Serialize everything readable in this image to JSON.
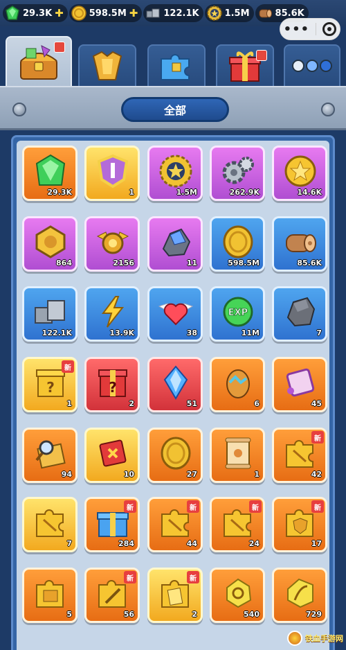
{
  "resources": [
    {
      "name": "gem",
      "value": "29.3K",
      "plus": true,
      "icon": "green-gem-icon",
      "color": "#3fcf5a"
    },
    {
      "name": "coin",
      "value": "598.5M",
      "plus": true,
      "icon": "gold-coin-icon",
      "color": "#f1c232"
    },
    {
      "name": "iron",
      "value": "122.1K",
      "plus": false,
      "icon": "iron-ingot-icon",
      "color": "#9aa4b0"
    },
    {
      "name": "medal",
      "value": "1.5M",
      "plus": false,
      "icon": "gear-medal-icon",
      "color": "#e5b93a"
    },
    {
      "name": "log",
      "value": "85.6K",
      "plus": false,
      "icon": "wood-log-icon",
      "color": "#b87845"
    }
  ],
  "capsule": {
    "more": "•••"
  },
  "tabs": [
    {
      "name": "treasure",
      "icon": "treasure-chest-icon",
      "active": true,
      "badge": true
    },
    {
      "name": "armor",
      "icon": "armor-icon",
      "active": false,
      "badge": false
    },
    {
      "name": "puzzle",
      "icon": "puzzle-piece-icon",
      "active": false,
      "badge": false
    },
    {
      "name": "gift",
      "icon": "gift-box-icon",
      "active": false,
      "badge": true
    },
    {
      "name": "more",
      "icon": "more-dots-icon",
      "active": false,
      "badge": false
    }
  ],
  "filter": {
    "label": "全部"
  },
  "items": [
    {
      "icon": "green-gem-icon",
      "qty": "29.3K",
      "rarity": "orange",
      "new": false
    },
    {
      "icon": "shield-sword-badge-icon",
      "qty": "1",
      "rarity": "gold",
      "new": false
    },
    {
      "icon": "star-gear-medal-icon",
      "qty": "1.5M",
      "rarity": "purple",
      "new": false
    },
    {
      "icon": "gears-icon",
      "qty": "262.9K",
      "rarity": "purple",
      "new": false
    },
    {
      "icon": "star-coin-icon",
      "qty": "14.6K",
      "rarity": "purple",
      "new": false
    },
    {
      "icon": "gold-shield-badge-icon",
      "qty": "864",
      "rarity": "purple",
      "new": false
    },
    {
      "icon": "winged-medal-icon",
      "qty": "2156",
      "rarity": "purple",
      "new": false
    },
    {
      "icon": "blue-crystal-ore-icon",
      "qty": "11",
      "rarity": "purple",
      "new": false
    },
    {
      "icon": "gold-coin-icon",
      "qty": "598.5M",
      "rarity": "blue",
      "new": false
    },
    {
      "icon": "wood-log-icon",
      "qty": "85.6K",
      "rarity": "blue",
      "new": false
    },
    {
      "icon": "iron-ingot-icon",
      "qty": "122.1K",
      "rarity": "blue",
      "new": false
    },
    {
      "icon": "lightning-icon",
      "qty": "13.9K",
      "rarity": "blue",
      "new": false
    },
    {
      "icon": "winged-heart-icon",
      "qty": "38",
      "rarity": "blue",
      "new": false
    },
    {
      "icon": "exp-orb-icon",
      "qty": "11M",
      "rarity": "blue",
      "new": false
    },
    {
      "icon": "stone-ore-icon",
      "qty": "7",
      "rarity": "blue",
      "new": false
    },
    {
      "icon": "mystery-gold-box-icon",
      "qty": "1",
      "rarity": "gold",
      "new": true
    },
    {
      "icon": "mystery-red-box-icon",
      "qty": "2",
      "rarity": "red",
      "new": false
    },
    {
      "icon": "blue-crystal-icon",
      "qty": "51",
      "rarity": "red",
      "new": false
    },
    {
      "icon": "dragon-egg-icon",
      "qty": "6",
      "rarity": "orange",
      "new": false
    },
    {
      "icon": "purple-scroll-icon",
      "qty": "45",
      "rarity": "orange",
      "new": false
    },
    {
      "icon": "magnifier-map-icon",
      "qty": "94",
      "rarity": "orange",
      "new": false
    },
    {
      "icon": "red-scroll-icon",
      "qty": "10",
      "rarity": "gold",
      "new": false
    },
    {
      "icon": "gold-coin-icon",
      "qty": "27",
      "rarity": "orange",
      "new": false
    },
    {
      "icon": "parchment-scroll-icon",
      "qty": "1",
      "rarity": "orange",
      "new": false
    },
    {
      "icon": "puzzle-fragment-icon",
      "qty": "42",
      "rarity": "orange",
      "new": true
    },
    {
      "icon": "puzzle-fragment-icon",
      "qty": "7",
      "rarity": "gold",
      "new": false
    },
    {
      "icon": "blue-gift-chest-icon",
      "qty": "284",
      "rarity": "orange",
      "new": true
    },
    {
      "icon": "puzzle-fragment-icon",
      "qty": "44",
      "rarity": "orange",
      "new": true
    },
    {
      "icon": "puzzle-fragment-icon",
      "qty": "24",
      "rarity": "orange",
      "new": true
    },
    {
      "icon": "shield-puzzle-icon",
      "qty": "17",
      "rarity": "orange",
      "new": true
    },
    {
      "icon": "book-puzzle-icon",
      "qty": "5",
      "rarity": "orange",
      "new": false
    },
    {
      "icon": "sword-puzzle-icon",
      "qty": "56",
      "rarity": "orange",
      "new": true
    },
    {
      "icon": "card-puzzle-icon",
      "qty": "2",
      "rarity": "gold",
      "new": true
    },
    {
      "icon": "yellow-rune-stone-icon",
      "qty": "540",
      "rarity": "orange",
      "new": false
    },
    {
      "icon": "yellow-bow-stone-icon",
      "qty": "729",
      "rarity": "orange",
      "new": false
    }
  ],
  "new_label": "新",
  "watermark": {
    "text": "铁血手游网"
  }
}
